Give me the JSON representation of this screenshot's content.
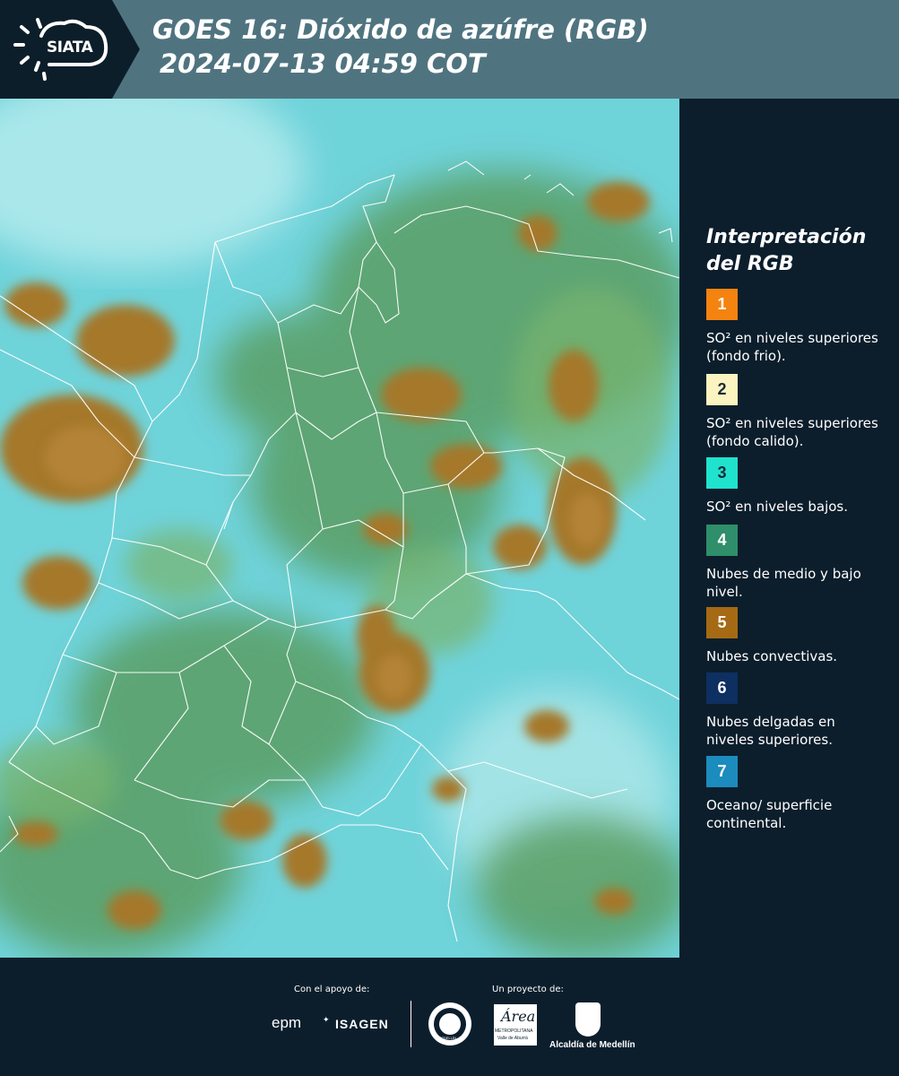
{
  "header": {
    "logo_text": "SIATA",
    "title_line1": "GOES 16: Dióxido de azúfre (RGB)",
    "title_line2": "2024-07-13 04:59 COT"
  },
  "legend": {
    "title": "Interpretación del RGB",
    "items": [
      {
        "number": "1",
        "color": "#f48310",
        "label": "SO² en niveles superiores (fondo frio)."
      },
      {
        "number": "2",
        "color": "#fbf4c0",
        "label": "SO² en niveles superiores (fondo calido)."
      },
      {
        "number": "3",
        "color": "#1fe3cd",
        "label": "SO² en niveles bajos."
      },
      {
        "number": "4",
        "color": "#2e8f6a",
        "label": "Nubes de medio y bajo nivel."
      },
      {
        "number": "5",
        "color": "#a56a13",
        "label": "Nubes convectivas."
      },
      {
        "number": "6",
        "color": "#0d2f62",
        "label": "Nubes delgadas en niveles superiores."
      },
      {
        "number": "7",
        "color": "#1b8cbd",
        "label": "Oceano/ superficie continental."
      }
    ]
  },
  "footer": {
    "support_caption": "Con el apoyo de:",
    "project_caption": "Un proyecto de:",
    "epm": "epm",
    "isagen": "ISAGEN",
    "area_word": "Área",
    "area_sub1": "METROPOLITANA",
    "area_sub2": "Valle de Aburrá",
    "alcaldia": "Alcaldía de Medellín",
    "seal_text": "MEDELLÍN"
  },
  "map_colors": {
    "background": "#67cfd7",
    "cloud": "#a5782c",
    "green": "#5f9e63",
    "borders": "#ffffff"
  }
}
